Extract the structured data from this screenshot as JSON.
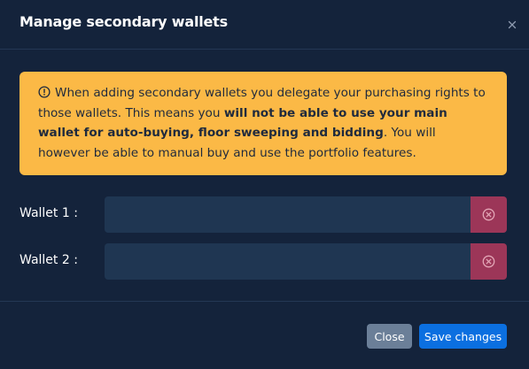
{
  "modal": {
    "title": "Manage secondary wallets"
  },
  "alert": {
    "icon": "alert-circle-icon",
    "text_1": "When adding secondary wallets you delegate your purchasing rights to those wallets. This means you ",
    "text_bold": "will not be able to use your main wallet for auto-buying, floor sweeping and bidding",
    "text_2": ". You will however be able to manual buy and use the portfolio features.",
    "background": "#fbb946"
  },
  "wallets": [
    {
      "label": "Wallet 1 :",
      "value": ""
    },
    {
      "label": "Wallet 2 :",
      "value": ""
    }
  ],
  "footer": {
    "close_label": "Close",
    "save_label": "Save changes"
  },
  "colors": {
    "background": "#14233b",
    "input_bg": "#1f3652",
    "remove_bg": "#9c3658",
    "primary": "#0b6fe0",
    "secondary": "#6b7f98"
  }
}
